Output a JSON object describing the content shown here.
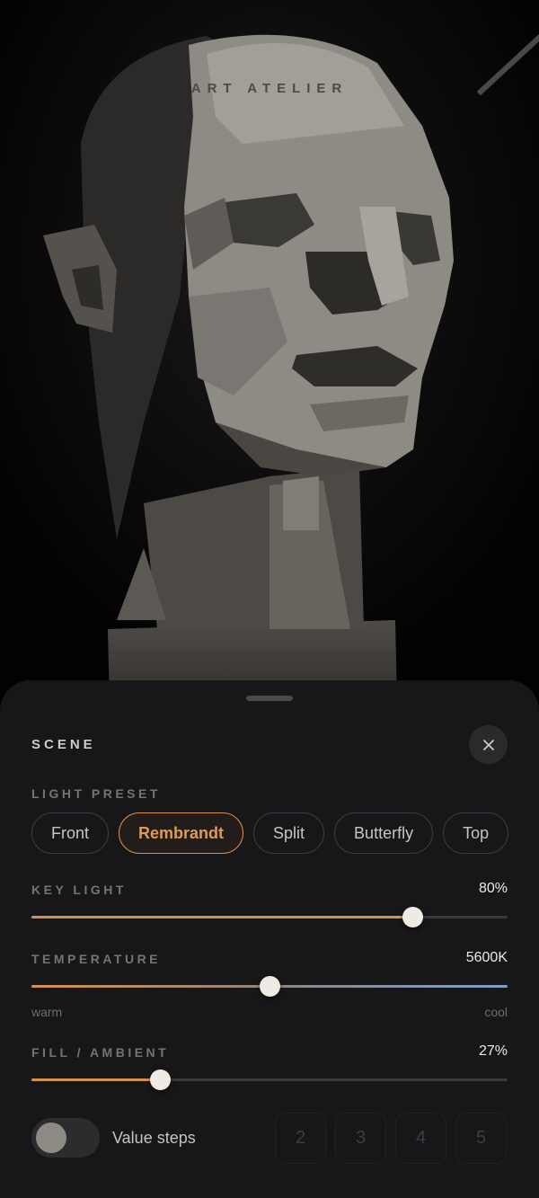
{
  "brand": "ART ATELIER",
  "scene": {
    "title": "SCENE",
    "close_icon": "close-icon"
  },
  "light_preset": {
    "label": "LIGHT PRESET",
    "options": [
      "Front",
      "Rembrandt",
      "Split",
      "Butterfly",
      "Top"
    ],
    "selected": "Rembrandt"
  },
  "key_light": {
    "label": "KEY LIGHT",
    "value_text": "80%",
    "value": 0.8
  },
  "temperature": {
    "label": "TEMPERATURE",
    "value_text": "5600K",
    "value": 0.5,
    "min_label": "warm",
    "max_label": "cool"
  },
  "fill_ambient": {
    "label": "FILL / AMBIENT",
    "value_text": "27%",
    "value": 0.27
  },
  "value_steps": {
    "label": "Value steps",
    "enabled": false,
    "options": [
      "2",
      "3",
      "4",
      "5"
    ]
  },
  "colors": {
    "accent": "#d7914f",
    "cool": "#7f9fc9",
    "sheet": "#171719"
  }
}
